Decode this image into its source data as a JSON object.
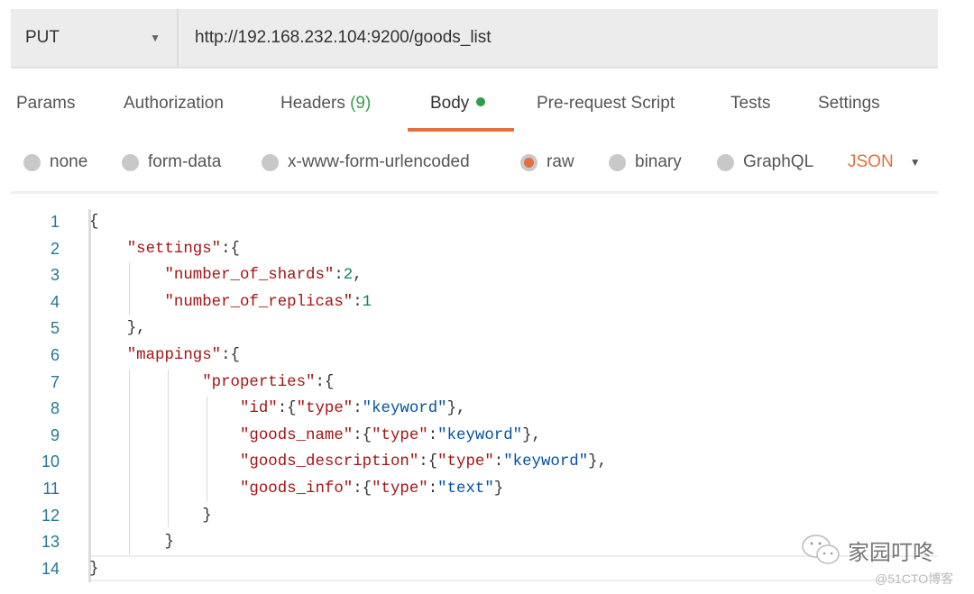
{
  "request": {
    "method": "PUT",
    "url": "http://192.168.232.104:9200/goods_list"
  },
  "tabs": [
    {
      "label": "Params"
    },
    {
      "label": "Authorization"
    },
    {
      "label": "Headers",
      "count": "(9)"
    },
    {
      "label": "Body",
      "active": true
    },
    {
      "label": "Pre-request Script"
    },
    {
      "label": "Tests"
    },
    {
      "label": "Settings"
    }
  ],
  "body_types": [
    {
      "label": "none",
      "selected": false
    },
    {
      "label": "form-data",
      "selected": false
    },
    {
      "label": "x-www-form-urlencoded",
      "selected": false
    },
    {
      "label": "raw",
      "selected": true
    },
    {
      "label": "binary",
      "selected": false
    },
    {
      "label": "GraphQL",
      "selected": false
    }
  ],
  "format": "JSON",
  "colors": {
    "accent": "#e5703f",
    "active_dot": "#2e9e48",
    "key": "#a31515",
    "string": "#0451a5",
    "number": "#098658"
  },
  "code_lines": [
    "{",
    "    \"settings\":{",
    "        \"number_of_shards\":2,",
    "        \"number_of_replicas\":1",
    "    },",
    "    \"mappings\":{",
    "            \"properties\":{",
    "                \"id\":{\"type\":\"keyword\"},",
    "                \"goods_name\":{\"type\":\"keyword\"},",
    "                \"goods_description\":{\"type\":\"keyword\"},",
    "                \"goods_info\":{\"type\":\"text\"}",
    "            }",
    "        }",
    "}"
  ],
  "watermark": {
    "name": "家园叮咚",
    "source": "@51CTO博客",
    "icon": "wechat-icon"
  }
}
